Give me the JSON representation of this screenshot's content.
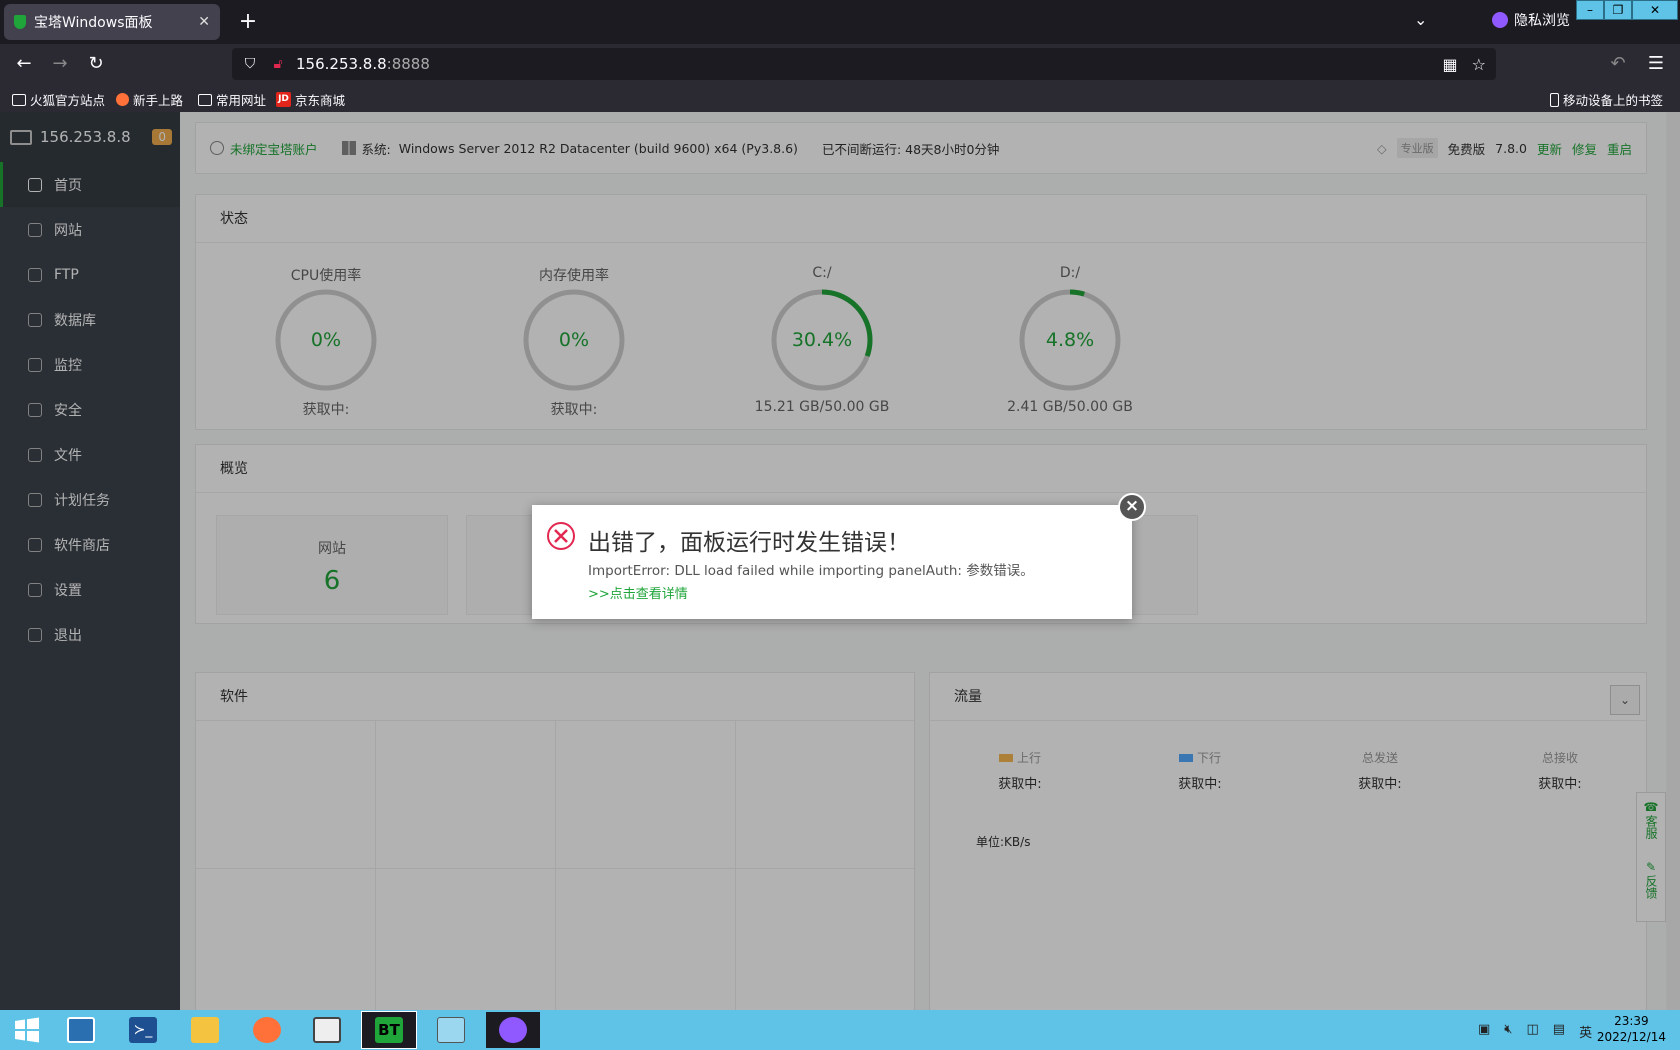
{
  "browser": {
    "tab_title": "宝塔Windows面板",
    "tab_close": "✕",
    "new_tab": "+",
    "private_label": "隐私浏览",
    "url_host": "156.253.8.8",
    "url_port": ":8888",
    "bookmarks": [
      "火狐官方站点",
      "新手上路",
      "常用网址",
      "京东商城"
    ],
    "mobile_bookmarks": "移动设备上的书签"
  },
  "sidebar": {
    "host": "156.253.8.8",
    "badge": "0",
    "items": [
      {
        "label": "首页",
        "icon": "home-icon"
      },
      {
        "label": "网站",
        "icon": "globe-icon"
      },
      {
        "label": "FTP",
        "icon": "ftp-icon"
      },
      {
        "label": "数据库",
        "icon": "database-icon"
      },
      {
        "label": "监控",
        "icon": "monitor-icon"
      },
      {
        "label": "安全",
        "icon": "shield-icon"
      },
      {
        "label": "文件",
        "icon": "folder-icon"
      },
      {
        "label": "计划任务",
        "icon": "calendar-icon"
      },
      {
        "label": "软件商店",
        "icon": "apps-icon"
      },
      {
        "label": "设置",
        "icon": "gear-icon"
      },
      {
        "label": "退出",
        "icon": "logout-icon"
      }
    ]
  },
  "topinfo": {
    "account": "未绑定宝塔账户",
    "system_label": "系统:",
    "system_value": "Windows Server 2012 R2 Datacenter (build 9600) x64 (Py3.8.6)",
    "uptime": "已不间断运行: 48天8小时0分钟",
    "pro_label": "专业版",
    "edition": "免费版",
    "version": "7.8.0",
    "update": "更新",
    "repair": "修复",
    "restart": "重启"
  },
  "status": {
    "title": "状态",
    "gauges": [
      {
        "label": "CPU使用率",
        "value": "0%",
        "sub": "获取中:",
        "pct": 0
      },
      {
        "label": "内存使用率",
        "value": "0%",
        "sub": "获取中:",
        "pct": 0
      },
      {
        "label": "C:/",
        "value": "30.4%",
        "sub": "15.21 GB/50.00 GB",
        "pct": 30.4
      },
      {
        "label": "D:/",
        "value": "4.8%",
        "sub": "2.41 GB/50.00 GB",
        "pct": 4.8
      }
    ]
  },
  "overview": {
    "title": "概览",
    "site_label": "网站",
    "site_count": "6"
  },
  "software": {
    "title": "软件"
  },
  "traffic": {
    "title": "流量",
    "cols": [
      {
        "label": "上行",
        "value": "获取中:",
        "color": "#f7b851"
      },
      {
        "label": "下行",
        "value": "获取中:",
        "color": "#52a9ff"
      },
      {
        "label": "总发送",
        "value": "获取中:"
      },
      {
        "label": "总接收",
        "value": "获取中:"
      }
    ],
    "unit": "单位:KB/s"
  },
  "sidetools": {
    "service": "客服",
    "feedback": "反馈"
  },
  "modal": {
    "title": "出错了，面板运行时发生错误！",
    "message": "ImportError: DLL load failed while importing panelAuth: 参数错误。",
    "link": ">>点击查看详情"
  },
  "taskbar": {
    "bt_label": "BT",
    "time": "23:39",
    "date": "2022/12/14",
    "ime": "英"
  },
  "colors": {
    "accent": "#20a53a",
    "error": "#e22850"
  }
}
